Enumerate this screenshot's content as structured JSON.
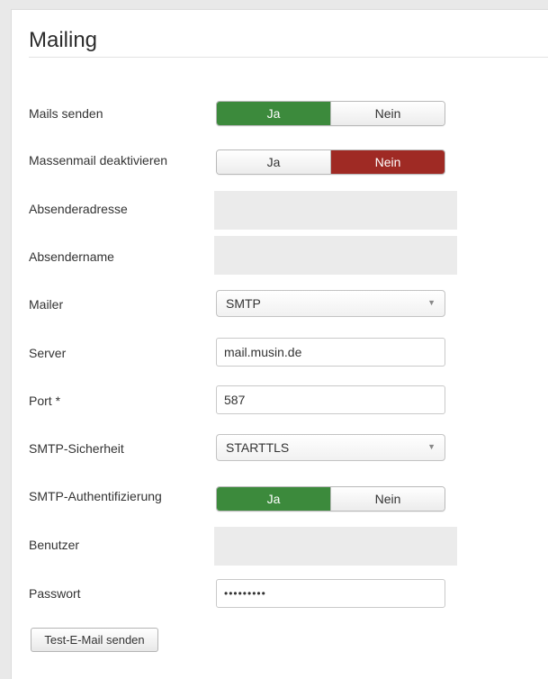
{
  "section": {
    "title": "Mailing"
  },
  "fields": {
    "mails_senden": {
      "label": "Mails senden",
      "yes": "Ja",
      "no": "Nein",
      "selected": "Ja"
    },
    "massenmail": {
      "label": "Massenmail deaktivieren",
      "yes": "Ja",
      "no": "Nein",
      "selected": "Nein"
    },
    "absenderadresse": {
      "label": "Absenderadresse"
    },
    "absendername": {
      "label": "Absendername"
    },
    "mailer": {
      "label": "Mailer",
      "value": "SMTP"
    },
    "server": {
      "label": "Server",
      "value": "mail.musin.de"
    },
    "port": {
      "label": "Port *",
      "value": "587"
    },
    "smtp_security": {
      "label": "SMTP-Sicherheit",
      "value": "STARTTLS"
    },
    "smtp_auth": {
      "label": "SMTP-Authentifizierung",
      "yes": "Ja",
      "no": "Nein",
      "selected": "Ja"
    },
    "benutzer": {
      "label": "Benutzer"
    },
    "passwort": {
      "label": "Passwort",
      "value": "•••••••••"
    }
  },
  "actions": {
    "test_mail": "Test-E-Mail senden"
  },
  "colors": {
    "active_green": "#3c8a3c",
    "active_red": "#9f2a24",
    "readonly_bg": "#ebebeb"
  },
  "icons": {
    "dropdown": "caret-down-icon"
  }
}
